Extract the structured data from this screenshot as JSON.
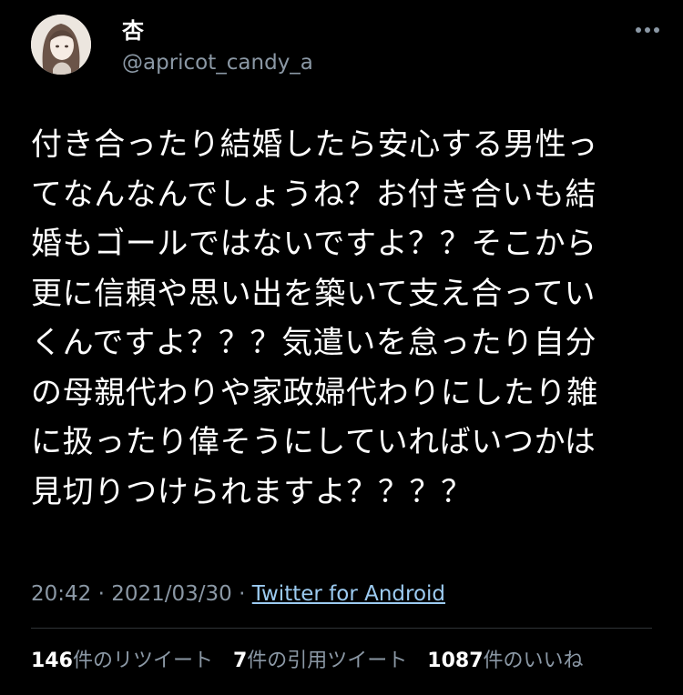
{
  "tweet": {
    "display_name": "杏",
    "handle": "@apricot_candy_a",
    "more_icon": "more-options-icon",
    "lines": [
      "付き合ったり結婚したら安心する男性っ",
      "てなんなんでしょうね？お付き合いも結",
      "婚もゴールではないですよ？？そこから",
      "更に信頼や思い出を築いて支え合ってい",
      "くんですよ？？？気遣いを怠ったり自分",
      "の母親代わりや家政婦代わりにしたり雑",
      "に扱ったり偉そうにしていればいつかは",
      "見切りつけられますよ？？？？"
    ],
    "time": "20:42",
    "separator": "·",
    "date": "2021/03/30",
    "source": "Twitter for Android"
  },
  "stats": {
    "retweets_count": "146",
    "retweets_label": "件のリツイート",
    "quotes_count": "7",
    "quotes_label": "件の引用ツイート",
    "likes_count": "1087",
    "likes_label": "件のいいね"
  },
  "colors": {
    "background": "#000000",
    "text": "#ffffff",
    "secondary": "#8b98a5",
    "link": "#9ccbf1",
    "divider": "#2f3336"
  }
}
